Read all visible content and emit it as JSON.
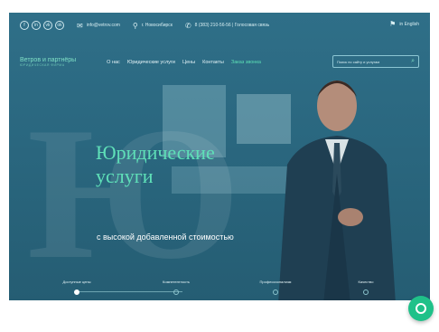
{
  "topbar": {
    "social": [
      "f",
      "in",
      "vk",
      "ok"
    ],
    "email": "info@vetrov.com",
    "city": "г. Новосибирск",
    "phone": "8 (383) 210-56-56 | Голосовая связь",
    "language": "in English"
  },
  "navbar": {
    "brand_line1": "Ветров и партнёры",
    "brand_line2": "ЮРИДИЧЕСКАЯ ФИРМА",
    "menu": [
      "О нас",
      "Юридические услуги",
      "Цены",
      "Контакты",
      "Заказ звонка"
    ],
    "search_placeholder": "Поиск по сайту и услугам"
  },
  "hero": {
    "watermark": "Ю",
    "title_line1": "Юридические",
    "title_line2": "услуги",
    "subtitle": "с высокой добавленной стоимостью"
  },
  "steps": [
    "Доступные цены",
    "Компетентность",
    "Профессионализм",
    "Качество"
  ],
  "colors": {
    "accent": "#5fe0b8",
    "overlay": "#2a677f",
    "chat": "#1fc189"
  }
}
